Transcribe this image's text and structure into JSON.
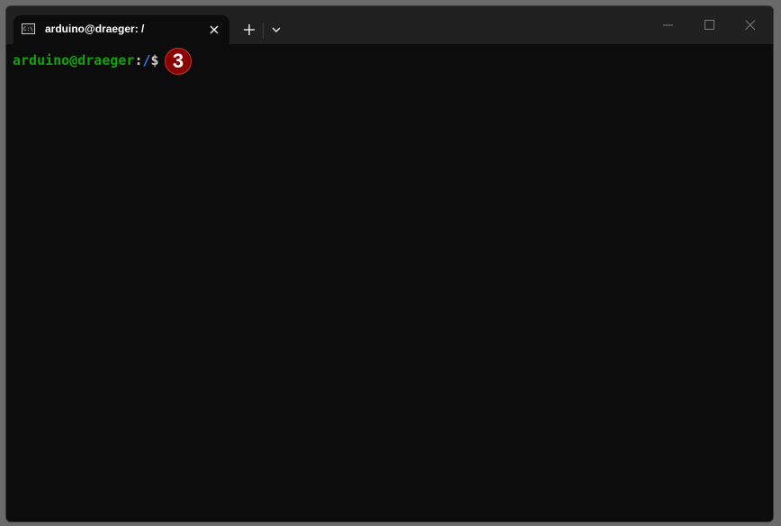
{
  "window": {
    "tab_title": "arduino@draeger: /",
    "tab_icon": "terminal-icon"
  },
  "titlebar": {
    "new_tab_icon": "plus-icon",
    "dropdown_icon": "chevron-down-icon",
    "minimize_icon": "minimize-icon",
    "maximize_icon": "maximize-icon",
    "close_icon": "close-icon"
  },
  "terminal": {
    "prompt_user": "arduino@draeger",
    "prompt_colon": ":",
    "prompt_path": "/",
    "prompt_dollar": "$",
    "colors": {
      "background": "#0c0c0c",
      "user": "#13a10e",
      "path": "#3b78ff",
      "text": "#cccccc"
    }
  },
  "annotation": {
    "step_number": "3",
    "color": "#8b0000"
  }
}
